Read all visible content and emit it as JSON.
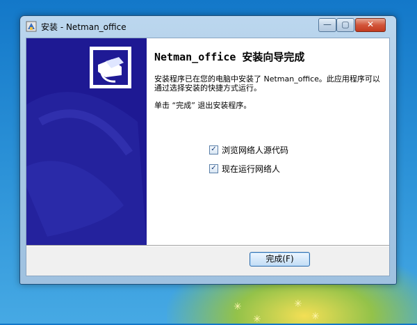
{
  "window": {
    "title": "安装 - Netman_office"
  },
  "titlebar": {
    "min_icon": "minimize-icon",
    "max_icon": "maximize-icon",
    "close_icon": "close-icon",
    "min_glyph": "—",
    "max_glyph": "▢",
    "close_glyph": "✕"
  },
  "wizard": {
    "heading": "Netman_office 安装向导完成",
    "line1": "安装程序已在您的电脑中安装了 Netman_office。此应用程序可以通过选择安装的快捷方式运行。",
    "line2": "单击 “完成” 退出安装程序。",
    "options": [
      {
        "label": "浏览网络人源代码",
        "checked": true
      },
      {
        "label": "现在运行网络人",
        "checked": true
      }
    ],
    "finish_label": "完成(F)"
  },
  "colors": {
    "banner_bg": "#1e1993",
    "content_bg": "#ffffff",
    "desktop_top": "#1378c9"
  }
}
